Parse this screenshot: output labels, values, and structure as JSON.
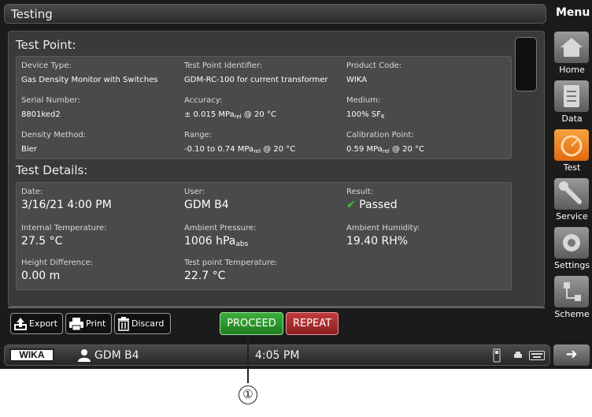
{
  "window": {
    "title": "Testing"
  },
  "menu": {
    "title": "Menu",
    "items": [
      {
        "label": "Home",
        "icon": "home-icon"
      },
      {
        "label": "Data",
        "icon": "clipboard-icon"
      },
      {
        "label": "Test",
        "icon": "gauge-icon",
        "active": true
      },
      {
        "label": "Service",
        "icon": "wrench-icon"
      },
      {
        "label": "Settings",
        "icon": "gear-icon"
      },
      {
        "label": "Scheme",
        "icon": "scheme-icon"
      }
    ]
  },
  "test_point": {
    "title": "Test Point:",
    "device_type_label": "Device Type:",
    "device_type_value": "Gas Density Monitor with Switches",
    "identifier_label": "Test Point Identifier:",
    "identifier_value": "GDM-RC-100 for current transformer",
    "product_code_label": "Product Code:",
    "product_code_value": "WIKA",
    "serial_label": "Serial Number:",
    "serial_value": "8801ked2",
    "accuracy_label": "Accuracy:",
    "accuracy_value": "± 0.015 MPa",
    "accuracy_sub": "rel",
    "accuracy_suffix": " @ 20 °C",
    "medium_label": "Medium:",
    "medium_value": "100% SF",
    "medium_sub": "6",
    "density_label": "Density Method:",
    "density_value": "Bier",
    "range_label": "Range:",
    "range_value": "-0.10 to 0.74 MPa",
    "range_sub": "rel",
    "range_suffix": " @ 20 °C",
    "calibration_label": "Calibration Point:",
    "calibration_value": "0.59 MPa",
    "calibration_sub": "rel",
    "calibration_suffix": " @ 20 °C"
  },
  "test_details": {
    "title": "Test Details:",
    "date_label": "Date:",
    "date_value": "3/16/21 4:00 PM",
    "user_label": "User:",
    "user_value": "GDM B4",
    "result_label": "Result:",
    "result_value": "Passed",
    "internal_temp_label": "Internal Temperature:",
    "internal_temp_value": "27.5 °C",
    "ambient_pressure_label": "Ambient Pressure:",
    "ambient_pressure_value": "1006 hPa",
    "ambient_pressure_sub": "abs",
    "ambient_humidity_label": "Ambient Humidity:",
    "ambient_humidity_value": "19.40 RH%",
    "height_label": "Height Difference:",
    "height_value": "0.00 m",
    "tp_temp_label": "Test point Temperature:",
    "tp_temp_value": "22.7 °C"
  },
  "actions": {
    "export": "Export",
    "print": "Print",
    "discard": "Discard",
    "proceed": "PROCEED",
    "repeat": "REPEAT"
  },
  "status": {
    "brand": "WIKA",
    "user": "GDM B4",
    "time": "4:05 PM"
  },
  "callout": {
    "number": "①"
  },
  "colors": {
    "accent_orange": "#f08a24",
    "proceed_green": "#2e9a2e",
    "repeat_red": "#b02c2c"
  }
}
